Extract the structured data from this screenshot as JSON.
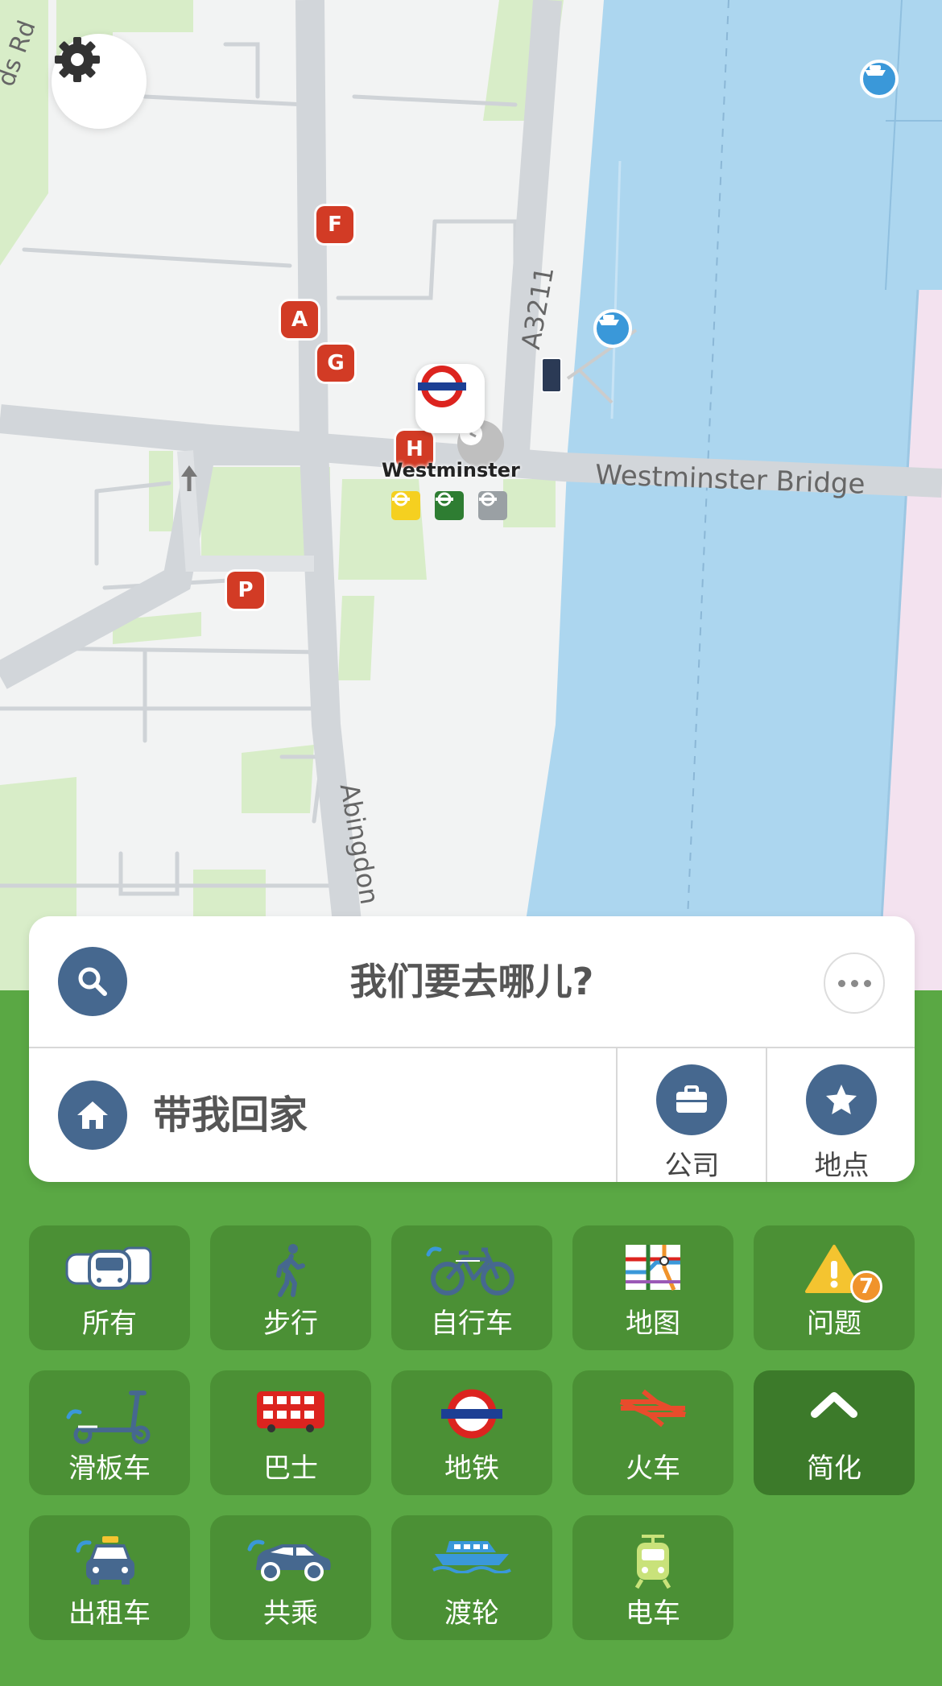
{
  "map": {
    "street_labels": {
      "rd": "ds Rd",
      "a3211": "A3211",
      "bridge": "Westminster Bridge",
      "abingdon": "Abingdon"
    },
    "station": {
      "name": "Westminster"
    },
    "exits": [
      "F",
      "A",
      "G",
      "H",
      "P"
    ]
  },
  "search": {
    "placeholder": "我们要去哪儿?",
    "home_label": "带我回家",
    "work_label": "公司",
    "places_label": "地点"
  },
  "modes": [
    {
      "label": "所有",
      "icon": "all-modes-icon"
    },
    {
      "label": "步行",
      "icon": "walk-icon"
    },
    {
      "label": "自行车",
      "icon": "bicycle-icon"
    },
    {
      "label": "地图",
      "icon": "tube-map-icon"
    },
    {
      "label": "问题",
      "icon": "warning-icon",
      "badge": "7"
    },
    {
      "label": "滑板车",
      "icon": "scooter-icon"
    },
    {
      "label": "巴士",
      "icon": "bus-icon"
    },
    {
      "label": "地铁",
      "icon": "underground-icon"
    },
    {
      "label": "火车",
      "icon": "national-rail-icon"
    },
    {
      "label": "简化",
      "icon": "chevron-up-icon"
    },
    {
      "label": "出租车",
      "icon": "taxi-icon"
    },
    {
      "label": "共乘",
      "icon": "car-share-icon"
    },
    {
      "label": "渡轮",
      "icon": "ferry-icon"
    },
    {
      "label": "电车",
      "icon": "tram-icon"
    }
  ],
  "colors": {
    "panel_green": "#5aa844",
    "tile_green": "#4b9035",
    "river_blue": "#acd6ef",
    "icon_blue": "#46688f",
    "exit_red": "#d23b25",
    "badge_orange": "#f0932b"
  }
}
